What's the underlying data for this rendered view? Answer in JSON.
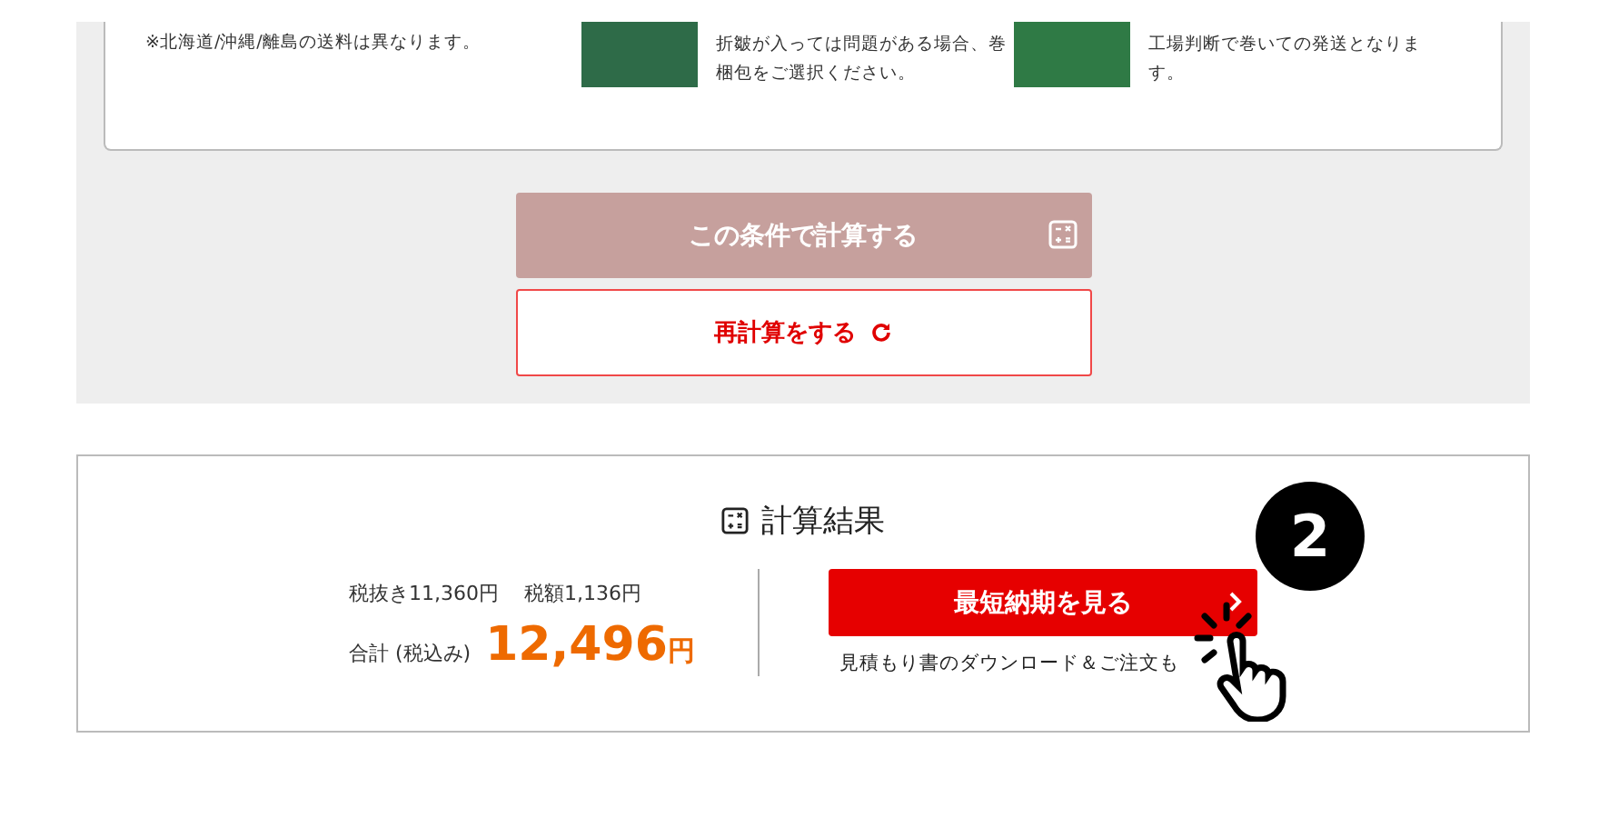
{
  "options_card": {
    "note": "※北海道/沖縄/離島の送料は異なります。",
    "options": [
      {
        "description": "折皺が入っては問題がある場合、巻梱包をご選択ください。"
      },
      {
        "description": "工場判断で巻いての発送となります。"
      }
    ]
  },
  "calculate_button": {
    "label": "この条件で計算する",
    "disabled": true
  },
  "recalculate_button": {
    "label": "再計算をする"
  },
  "result": {
    "title": "計算結果",
    "subtotal_label": "税抜き",
    "subtotal": "11,360",
    "subtotal_yen": "円",
    "tax_label": "税額",
    "tax": "1,136",
    "tax_yen": "円",
    "total_label": "合計 (税込み)",
    "total": "12,496",
    "total_yen": "円",
    "delivery_button": "最短納期を見る",
    "download_note": "見積もり書のダウンロード＆ご注文も"
  },
  "step_badge": "2"
}
